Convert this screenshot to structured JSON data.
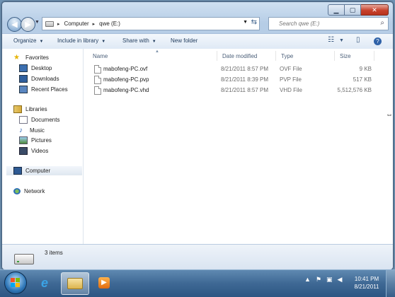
{
  "window": {
    "caption_buttons": {
      "minimize": "▁",
      "maximize": "▢",
      "close": "✕"
    }
  },
  "address_bar": {
    "segments": [
      "Computer",
      "qwe (E:)"
    ],
    "separator": "▸"
  },
  "search": {
    "placeholder": "Search qwe (E:)"
  },
  "toolbar": {
    "organize": "Organize",
    "include_in_library": "Include in library",
    "share_with": "Share with",
    "new_folder": "New folder"
  },
  "navigation": {
    "favorites": {
      "label": "Favorites",
      "items": [
        {
          "label": "Desktop",
          "icon": "desktop-icon"
        },
        {
          "label": "Downloads",
          "icon": "downloads-icon"
        },
        {
          "label": "Recent Places",
          "icon": "recent-places-icon"
        }
      ]
    },
    "libraries": {
      "label": "Libraries",
      "items": [
        {
          "label": "Documents",
          "icon": "documents-icon"
        },
        {
          "label": "Music",
          "icon": "music-icon"
        },
        {
          "label": "Pictures",
          "icon": "pictures-icon"
        },
        {
          "label": "Videos",
          "icon": "videos-icon"
        }
      ]
    },
    "computer": {
      "label": "Computer"
    },
    "network": {
      "label": "Network"
    }
  },
  "columns": [
    "Name",
    "Date modified",
    "Type",
    "Size"
  ],
  "files": [
    {
      "name": "mabofeng-PC.ovf",
      "date": "8/21/2011 8:57 PM",
      "type": "OVF File",
      "size": "9 KB"
    },
    {
      "name": "mabofeng-PC.pvp",
      "date": "8/21/2011 8:39 PM",
      "type": "PVP File",
      "size": "517 KB"
    },
    {
      "name": "mabofeng-PC.vhd",
      "date": "8/21/2011 8:57 PM",
      "type": "VHD File",
      "size": "5,512,576 KB"
    }
  ],
  "details": {
    "item_count": "3 items"
  },
  "taskbar": {
    "clock_time": "10:41 PM",
    "clock_date": "8/21/2011"
  },
  "colors": {
    "accent": "#1e395b",
    "selection": "#dfe7f0"
  }
}
